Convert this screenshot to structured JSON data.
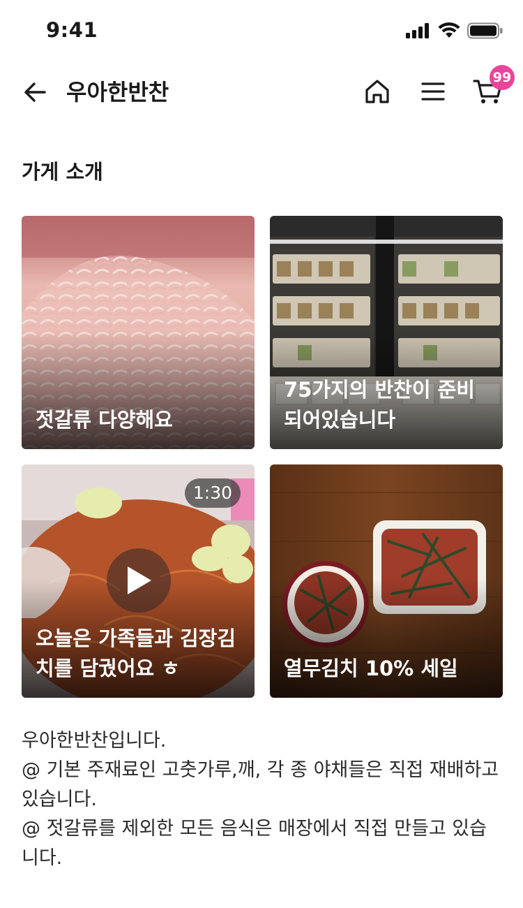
{
  "status_bar": {
    "time": "9:41",
    "icons": [
      "cellular-signal-icon",
      "wifi-icon",
      "battery-icon"
    ]
  },
  "header": {
    "title": "우아한반찬",
    "back_icon": "arrow-left-icon",
    "home_icon": "home-icon",
    "menu_icon": "hamburger-menu-icon",
    "cart_icon": "cart-icon",
    "cart_count": "99",
    "badge_color": "#e8459b"
  },
  "section": {
    "title": "가게 소개"
  },
  "cards": [
    {
      "caption": "젓갈류 다양해요",
      "type": "image"
    },
    {
      "caption": "75가지의 반찬이 준비\n되어있습니다",
      "type": "image"
    },
    {
      "caption": "오늘은 가족들과 김장김\n치를 담궜어요 ㅎ",
      "type": "video",
      "duration": "1:30",
      "play_icon": "play-icon"
    },
    {
      "caption": "열무김치 10% 세일",
      "type": "image"
    }
  ],
  "description": "우아한반찬입니다.\n@ 기본 주재료인 고춧가루,깨, 각 종 야채들은 직접 재배하고 있습니다.\n@ 젓갈류를 제외한 모든 음식은 매장에서 직접 만들고 있습니다."
}
